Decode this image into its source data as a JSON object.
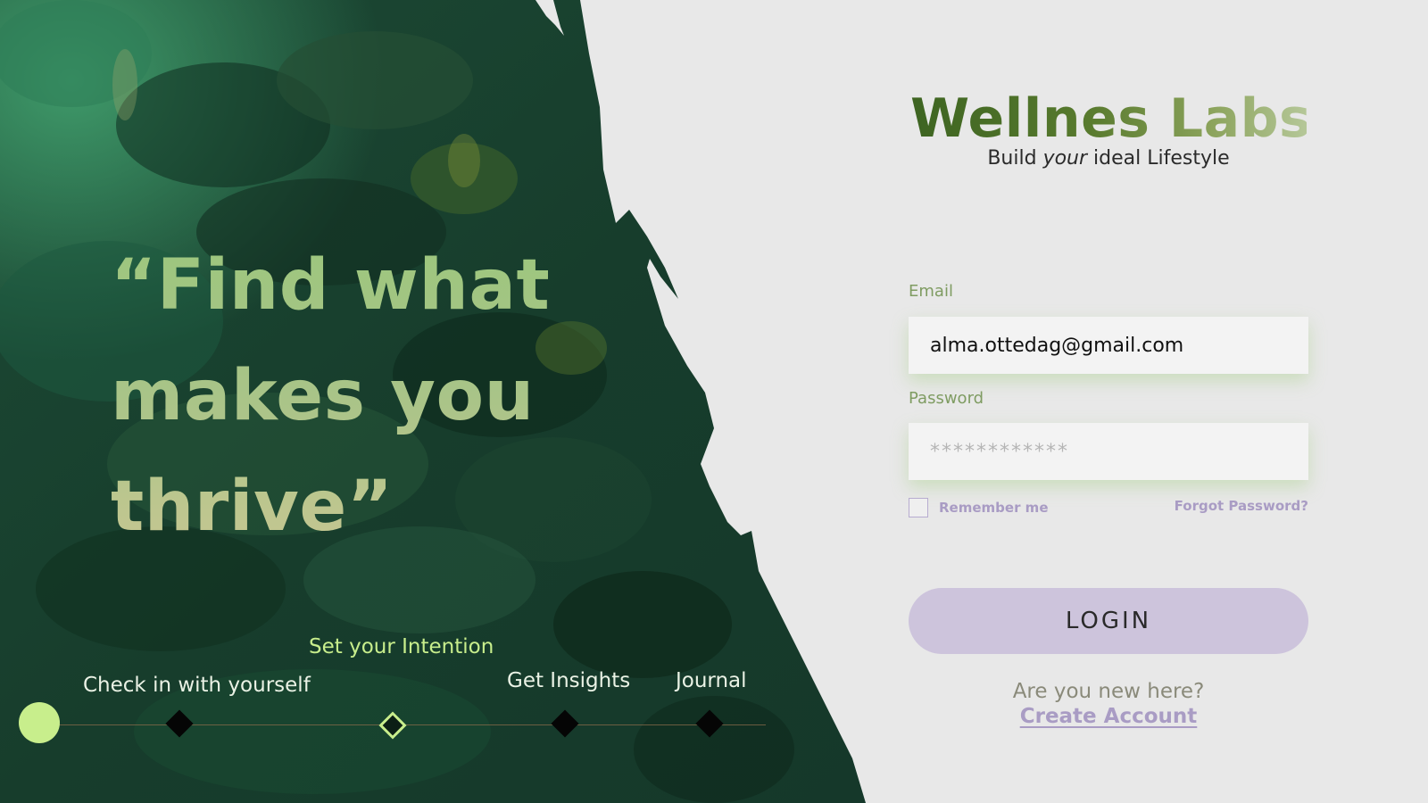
{
  "hero": {
    "quote_lines": [
      "“Find what",
      "makes you",
      "thrive”"
    ],
    "timeline": {
      "steps": [
        {
          "label": "Check in with yourself"
        },
        {
          "label": "Set your Intention",
          "active": true
        },
        {
          "label": "Get Insights"
        },
        {
          "label": "Journal"
        }
      ]
    }
  },
  "brand": {
    "title": "Wellnes Labs",
    "tagline_before": "Build ",
    "tagline_em": "your",
    "tagline_after": " ideal Lifestyle"
  },
  "form": {
    "email_label": "Email",
    "email_value": "alma.ottedag@gmail.com",
    "password_label": "Password",
    "password_value": "************",
    "remember_label": "Remember me",
    "forgot_label": "Forgot Password?",
    "login_label": "LOGIN",
    "new_here_text": "Are you new here?",
    "create_account_label": "Create Account"
  },
  "colors": {
    "accent_green": "#c8ee8c",
    "lavender": "#cdc4dc",
    "lavender_text": "#a99cc4",
    "panel_bg": "#e8e8e8"
  }
}
